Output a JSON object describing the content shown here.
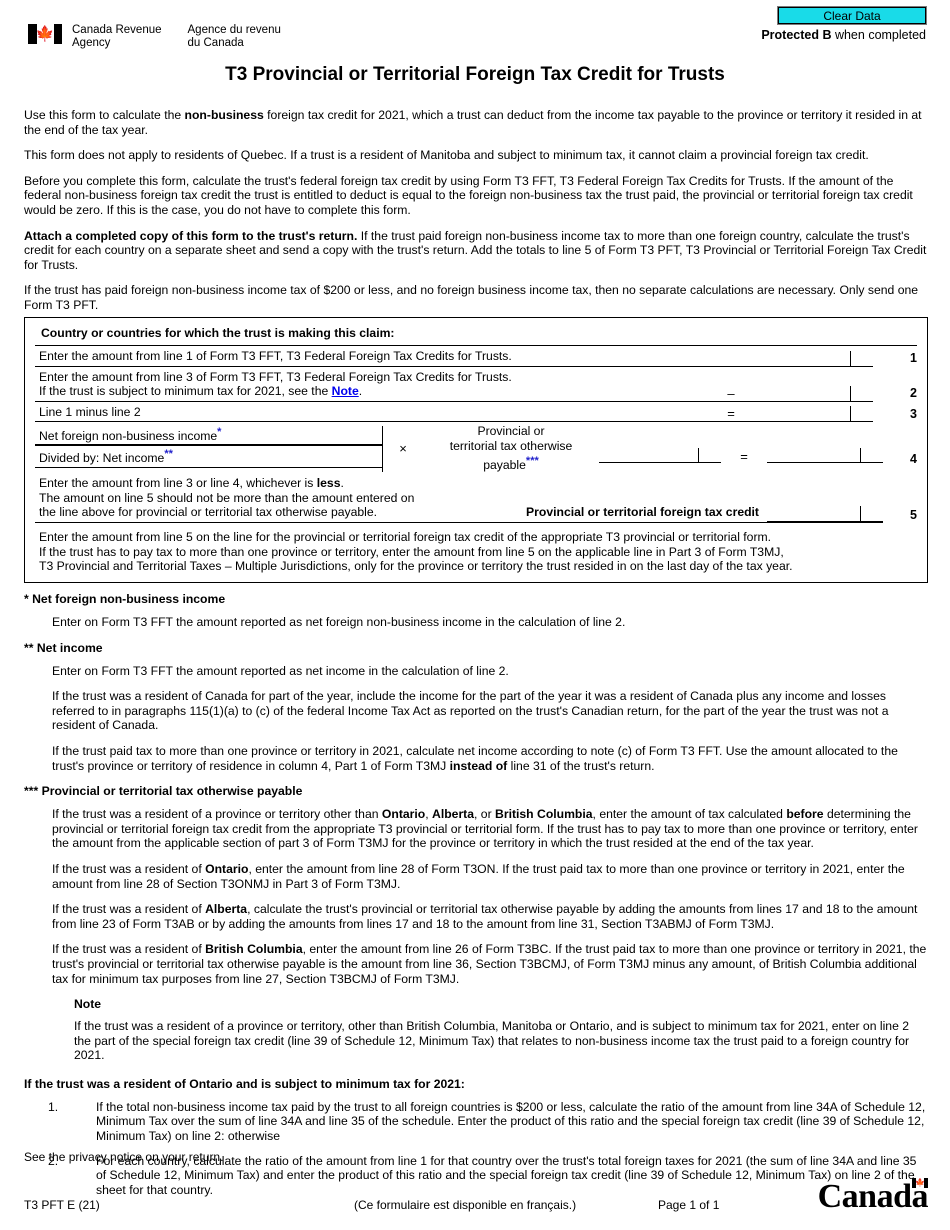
{
  "header": {
    "clear_data_label": "Clear Data",
    "clear_data_color": "#19dbe8",
    "protected_bold": "Protected B",
    "protected_rest": " when completed",
    "agency_en_line1": "Canada Revenue",
    "agency_en_line2": "Agency",
    "agency_fr_line1": "Agence du revenu",
    "agency_fr_line2": "du Canada",
    "flag_icon": "canada-flag-icon"
  },
  "title": "T3 Provincial or Territorial Foreign Tax Credit for Trusts",
  "intro": {
    "p1_a": "Use this form to calculate the ",
    "p1_b": "non-business",
    "p1_c": " foreign tax credit for 2021, which a trust can deduct from the income tax payable to the province or territory it resided in at the end of the tax year.",
    "p2": "This form does not apply to residents of Quebec. If a trust is a resident of Manitoba and subject to minimum tax, it cannot claim a provincial foreign tax credit.",
    "p3": "Before you complete this form, calculate the trust's federal foreign tax credit by using Form T3 FFT, T3 Federal Foreign Tax Credits for Trusts. If the amount of the federal non-business foreign tax credit the trust is entitled to deduct is equal to the foreign non-business tax the trust paid, the provincial or territorial foreign tax credit would be zero. If this is the case, you do not have to complete this form.",
    "p4_a": "Attach a completed copy of this form to the trust's return.",
    "p4_b": " If the trust paid foreign non-business income tax to more than one foreign country, calculate the trust's credit for each country on a separate sheet and send a copy with the trust's return. Add the totals to line 5 of Form T3 PFT, T3 Provincial or Territorial Foreign Tax Credit for Trusts.",
    "p5": "If the trust has paid foreign non-business income tax of $200 or less, and no foreign business income tax, then no separate calculations are necessary. Only send one Form T3 PFT."
  },
  "calc": {
    "claim_heading": "Country or countries for which the trust is making this claim:",
    "line1": {
      "text": "Enter the amount from line 1 of Form T3 FFT, T3 Federal Foreign Tax Credits for Trusts.",
      "op": "",
      "value": "",
      "number": "1"
    },
    "line2": {
      "text_a": "Enter the amount from line 3 of Form T3 FFT, T3 Federal Foreign Tax Credits for Trusts.",
      "text_b": "If the trust is subject to minimum tax for 2021, see the ",
      "note_link": "Note",
      "text_c": ".",
      "op": "–",
      "value": "",
      "number": "2"
    },
    "line3": {
      "text": "Line 1 minus line 2",
      "op": "=",
      "value": "",
      "number": "3"
    },
    "line4": {
      "numerator": "Net foreign non-business income",
      "numerator_mark": "*",
      "denominator": "Divided by: Net income",
      "denominator_mark": "**",
      "times": "×",
      "multiplier_l1": "Provincial or",
      "multiplier_l2": "territorial tax otherwise",
      "multiplier_l3": "payable",
      "multiplier_mark": "***",
      "multiplier_value": "",
      "equals": "=",
      "value": "",
      "number": "4"
    },
    "line5": {
      "text_l1_a": "Enter the amount from line 3 or line 4, whichever is ",
      "text_l1_b": "less",
      "text_l1_c": ".",
      "text_l2": "The amount on line 5 should not be more than the amount entered on",
      "text_l3": "the line above for provincial or territorial tax otherwise payable.",
      "label": "Provincial or territorial foreign tax credit",
      "value": "",
      "number": "5"
    },
    "closing_l1": "Enter the amount from line 5 on the line for the provincial or territorial foreign tax credit of the appropriate T3 provincial or territorial form.",
    "closing_l2": "If the trust has to pay tax to more than one province or territory, enter the amount from line 5 on the applicable line in Part 3 of Form T3MJ,",
    "closing_l3": "T3 Provincial and Territorial Taxes – Multiple Jurisdictions, only for the province or territory the trust resided in on the last day of the tax year."
  },
  "footnotes": {
    "fn1_head": "*  Net foreign non-business income",
    "fn1_body": "Enter on Form T3 FFT the amount reported as net foreign non-business income in the calculation of line 2.",
    "fn2_head": "**  Net income",
    "fn2_p1": "Enter on Form T3 FFT the amount reported as net income in the calculation of line 2.",
    "fn2_p2": "If the trust was a resident of Canada for part of the year, include the income for the part of the year it was a resident of Canada plus any income and losses referred to in paragraphs 115(1)(a) to (c) of the federal Income Tax Act as reported on the trust's Canadian return, for the part of the year the trust was not a resident of Canada.",
    "fn2_p3_a": "If the trust paid tax to more than one province or territory in 2021, calculate net income according to note (c) of Form T3 FFT. Use the amount allocated to the trust's province or territory of residence in column 4, Part 1 of Form T3MJ ",
    "fn2_p3_b": "instead of",
    "fn2_p3_c": " line 31 of the trust's return.",
    "fn3_head": "***  Provincial or territorial tax otherwise payable",
    "fn3_p1_a": "If the trust was a resident of a province or territory other than ",
    "fn3_p1_ont": "Ontario",
    "fn3_p1_b": ", ",
    "fn3_p1_ab": "Alberta",
    "fn3_p1_c": ", or ",
    "fn3_p1_bc": "British Columbia",
    "fn3_p1_d": ", enter the amount of tax calculated ",
    "fn3_p1_before": "before",
    "fn3_p1_e": " determining the provincial or territorial foreign tax credit from the appropriate T3 provincial or territorial form. If the trust has to pay tax to more than one province or territory, enter the amount from the applicable section of part 3 of Form T3MJ for the province or territory in which the trust resided at the end of the tax year.",
    "fn3_p2_a": "If the trust was a resident of ",
    "fn3_p2_ont": "Ontario",
    "fn3_p2_b": ", enter the amount from line 28 of Form T3ON. If the trust paid tax to more than one province or territory in 2021, enter the amount from line 28 of Section T3ONMJ in Part 3 of Form T3MJ.",
    "fn3_p3_a": "If the trust was a resident of ",
    "fn3_p3_ab": "Alberta",
    "fn3_p3_b": ", calculate the trust's provincial or territorial tax otherwise payable by adding the amounts from lines 17 and 18 to the amount from line 23 of Form T3AB or by adding the amounts from lines 17 and 18 to the amount from line 31, Section T3ABMJ of Form T3MJ.",
    "fn3_p4_a": "If the trust was a resident of ",
    "fn3_p4_bc": "British Columbia",
    "fn3_p4_b": ", enter the amount from line 26 of Form T3BC. If the trust paid tax to more than one province or territory in 2021, the trust's provincial or territorial tax otherwise payable is the amount from line 36, Section T3BCMJ, of Form T3MJ minus any amount, of British Columbia additional tax for minimum tax purposes from line 27, Section T3BCMJ of Form T3MJ.",
    "note_head": "Note",
    "note_body": "If the trust was a resident of a province or territory, other than British Columbia, Manitoba or Ontario, and is subject to minimum tax for 2021, enter on line 2 the part of the special foreign tax credit (line 39 of Schedule 12, Minimum Tax) that relates to non-business income tax the trust paid to a foreign country for 2021.",
    "ontario_head": "If the trust was a resident of Ontario and is subject to minimum tax for 2021:",
    "ontario_items": [
      {
        "marker": "1.",
        "text": "If the total non-business income tax paid by the trust to all foreign countries is $200 or less, calculate the ratio of the amount from line 34A of Schedule 12, Minimum Tax over the sum of line 34A and line 35 of the schedule. Enter the product of this ratio and the special foreign tax credit (line 39 of Schedule 12, Minimum Tax) on line 2: otherwise"
      },
      {
        "marker": "2.",
        "text": "For each country, calculate the ratio of the amount from line 1 for that country over the trust's total foreign taxes for 2021 (the sum of line 34A and line 35 of Schedule 12, Minimum Tax) and enter the product of this ratio and the special foreign tax credit (line 39 of Schedule 12, Minimum Tax) on line 2 of the sheet for that country."
      }
    ]
  },
  "footer": {
    "privacy": "See the privacy notice on your return.",
    "form_id": "T3 PFT E (21)",
    "french_note": "(Ce formulaire est disponible en français.)",
    "page_no": "Page 1 of 1",
    "wordmark": "Canad",
    "wordmark_tail": "a"
  }
}
